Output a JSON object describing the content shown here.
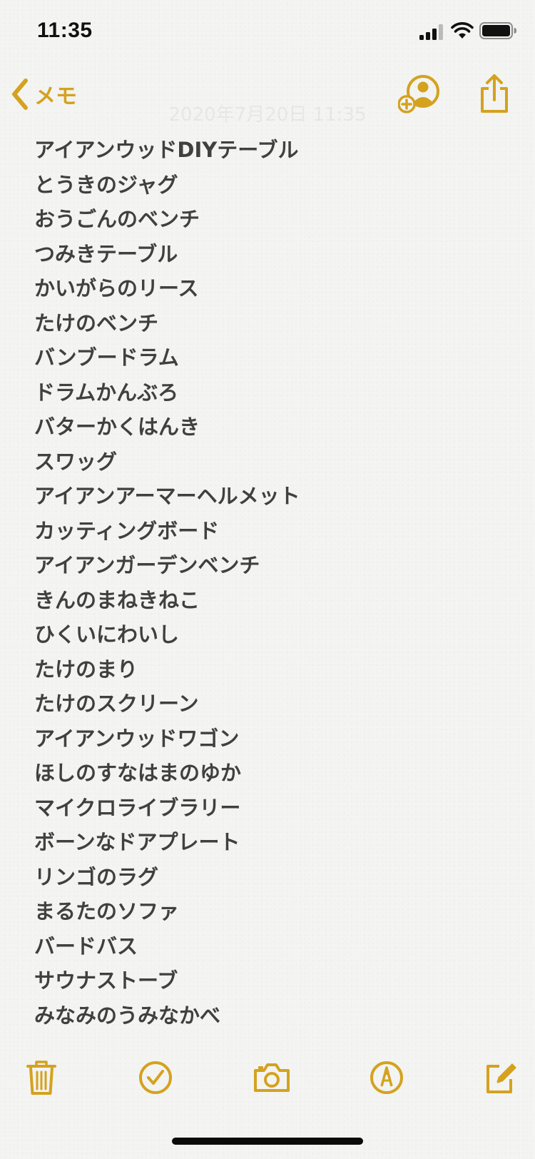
{
  "status_bar": {
    "time": "11:35"
  },
  "nav": {
    "back_label": "メモ",
    "date": "2020年7月20日 11:35"
  },
  "note": {
    "lines": [
      "アイアンウッドDIYテーブル",
      "とうきのジャグ",
      "おうごんのベンチ",
      "つみきテーブル",
      "かいがらのリース",
      "たけのベンチ",
      "バンブードラム",
      "ドラムかんぶろ",
      "バターかくはんき",
      "スワッグ",
      "アイアンアーマーヘルメット",
      "カッティングボード",
      "アイアンガーデンベンチ",
      "きんのまねきねこ",
      "ひくいにわいし",
      "たけのまり",
      "たけのスクリーン",
      "アイアンウッドワゴン",
      "ほしのすなはまのゆか",
      "マイクロライブラリー",
      "ボーンなドアプレート",
      "リンゴのラグ",
      "まるたのソファ",
      "バードバス",
      "サウナストーブ",
      "みなみのうみなかべ"
    ]
  },
  "toolbar": {
    "icons": [
      "trash-icon",
      "checklist-icon",
      "camera-icon",
      "markup-icon",
      "compose-icon"
    ]
  },
  "colors": {
    "accent": "#d4a21f",
    "text": "#404040",
    "background": "#f4f4f2"
  }
}
